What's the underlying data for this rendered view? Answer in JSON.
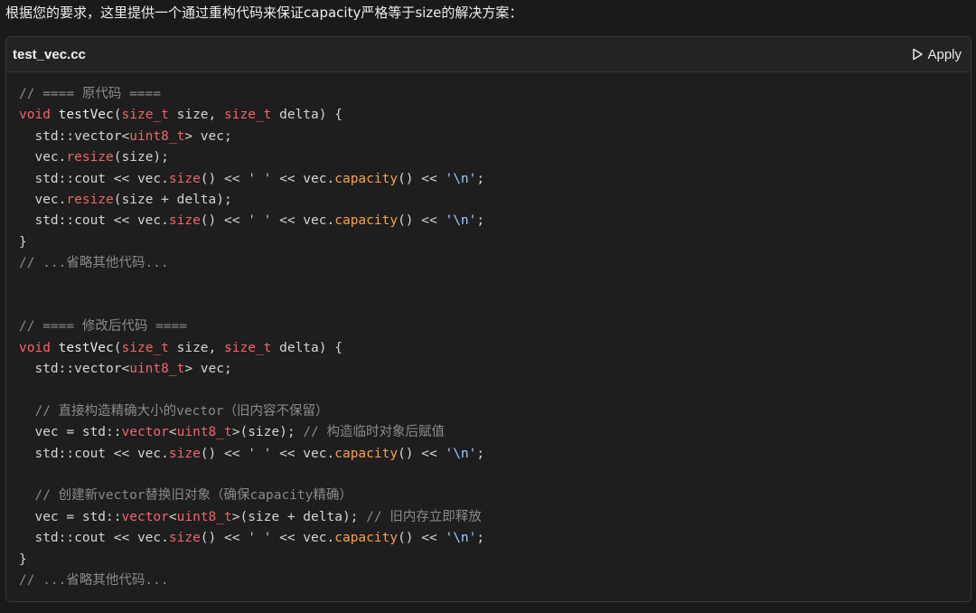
{
  "intro_text": "根据您的要求，这里提供一个通过重构代码来保证capacity严格等于size的解决方案：",
  "code_block": {
    "filename": "test_vec.cc",
    "apply_label": "Apply",
    "apply_icon": "play-icon",
    "colors": {
      "keyword": "#f0646d",
      "method": "#f0646d",
      "capacity": "#f5a24a",
      "comment": "#8a8a8a",
      "string": "#9ecbff"
    },
    "lines": [
      [
        {
          "t": "cm",
          "v": "// ==== 原代码 ===="
        }
      ],
      [
        {
          "t": "kw",
          "v": "void"
        },
        {
          "t": "pl",
          "v": " "
        },
        {
          "t": "fn",
          "v": "testVec"
        },
        {
          "t": "pl",
          "v": "("
        },
        {
          "t": "ty",
          "v": "size_t"
        },
        {
          "t": "pl",
          "v": " size, "
        },
        {
          "t": "ty",
          "v": "size_t"
        },
        {
          "t": "pl",
          "v": " delta) {"
        }
      ],
      [
        {
          "t": "pl",
          "v": "  std::vector<"
        },
        {
          "t": "ty",
          "v": "uint8_t"
        },
        {
          "t": "pl",
          "v": "> vec;"
        }
      ],
      [
        {
          "t": "pl",
          "v": "  vec."
        },
        {
          "t": "me",
          "v": "resize"
        },
        {
          "t": "pl",
          "v": "(size);"
        }
      ],
      [
        {
          "t": "pl",
          "v": "  std::cout << vec."
        },
        {
          "t": "me",
          "v": "size"
        },
        {
          "t": "pl",
          "v": "() << "
        },
        {
          "t": "st",
          "v": "' '"
        },
        {
          "t": "pl",
          "v": " << vec."
        },
        {
          "t": "cap",
          "v": "capacity"
        },
        {
          "t": "pl",
          "v": "() << "
        },
        {
          "t": "st",
          "v": "'\\n'"
        },
        {
          "t": "pl",
          "v": ";"
        }
      ],
      [
        {
          "t": "pl",
          "v": "  vec."
        },
        {
          "t": "me",
          "v": "resize"
        },
        {
          "t": "pl",
          "v": "(size + delta);"
        }
      ],
      [
        {
          "t": "pl",
          "v": "  std::cout << vec."
        },
        {
          "t": "me",
          "v": "size"
        },
        {
          "t": "pl",
          "v": "() << "
        },
        {
          "t": "st",
          "v": "' '"
        },
        {
          "t": "pl",
          "v": " << vec."
        },
        {
          "t": "cap",
          "v": "capacity"
        },
        {
          "t": "pl",
          "v": "() << "
        },
        {
          "t": "st",
          "v": "'\\n'"
        },
        {
          "t": "pl",
          "v": ";"
        }
      ],
      [
        {
          "t": "pl",
          "v": "}"
        }
      ],
      [
        {
          "t": "cm",
          "v": "// ...省略其他代码..."
        }
      ],
      [],
      [],
      [
        {
          "t": "cm",
          "v": "// ==== 修改后代码 ===="
        }
      ],
      [
        {
          "t": "kw",
          "v": "void"
        },
        {
          "t": "pl",
          "v": " "
        },
        {
          "t": "fn",
          "v": "testVec"
        },
        {
          "t": "pl",
          "v": "("
        },
        {
          "t": "ty",
          "v": "size_t"
        },
        {
          "t": "pl",
          "v": " size, "
        },
        {
          "t": "ty",
          "v": "size_t"
        },
        {
          "t": "pl",
          "v": " delta) {"
        }
      ],
      [
        {
          "t": "pl",
          "v": "  std::vector<"
        },
        {
          "t": "ty",
          "v": "uint8_t"
        },
        {
          "t": "pl",
          "v": "> vec;"
        }
      ],
      [],
      [
        {
          "t": "cm",
          "v": "  // 直接构造精确大小的vector（旧内容不保留）"
        }
      ],
      [
        {
          "t": "pl",
          "v": "  vec = std::"
        },
        {
          "t": "me",
          "v": "vector"
        },
        {
          "t": "pl",
          "v": "<"
        },
        {
          "t": "ty",
          "v": "uint8_t"
        },
        {
          "t": "pl",
          "v": ">(size); "
        },
        {
          "t": "cm",
          "v": "// 构造临时对象后赋值"
        }
      ],
      [
        {
          "t": "pl",
          "v": "  std::cout << vec."
        },
        {
          "t": "me",
          "v": "size"
        },
        {
          "t": "pl",
          "v": "() << "
        },
        {
          "t": "st",
          "v": "' '"
        },
        {
          "t": "pl",
          "v": " << vec."
        },
        {
          "t": "cap",
          "v": "capacity"
        },
        {
          "t": "pl",
          "v": "() << "
        },
        {
          "t": "st",
          "v": "'\\n'"
        },
        {
          "t": "pl",
          "v": ";"
        }
      ],
      [],
      [
        {
          "t": "cm",
          "v": "  // 创建新vector替换旧对象（确保capacity精确）"
        }
      ],
      [
        {
          "t": "pl",
          "v": "  vec = std::"
        },
        {
          "t": "me",
          "v": "vector"
        },
        {
          "t": "pl",
          "v": "<"
        },
        {
          "t": "ty",
          "v": "uint8_t"
        },
        {
          "t": "pl",
          "v": ">(size + delta); "
        },
        {
          "t": "cm",
          "v": "// 旧内存立即释放"
        }
      ],
      [
        {
          "t": "pl",
          "v": "  std::cout << vec."
        },
        {
          "t": "me",
          "v": "size"
        },
        {
          "t": "pl",
          "v": "() << "
        },
        {
          "t": "st",
          "v": "' '"
        },
        {
          "t": "pl",
          "v": " << vec."
        },
        {
          "t": "cap",
          "v": "capacity"
        },
        {
          "t": "pl",
          "v": "() << "
        },
        {
          "t": "st",
          "v": "'\\n'"
        },
        {
          "t": "pl",
          "v": ";"
        }
      ],
      [
        {
          "t": "pl",
          "v": "}"
        }
      ],
      [
        {
          "t": "cm",
          "v": "// ...省略其他代码..."
        }
      ]
    ]
  }
}
